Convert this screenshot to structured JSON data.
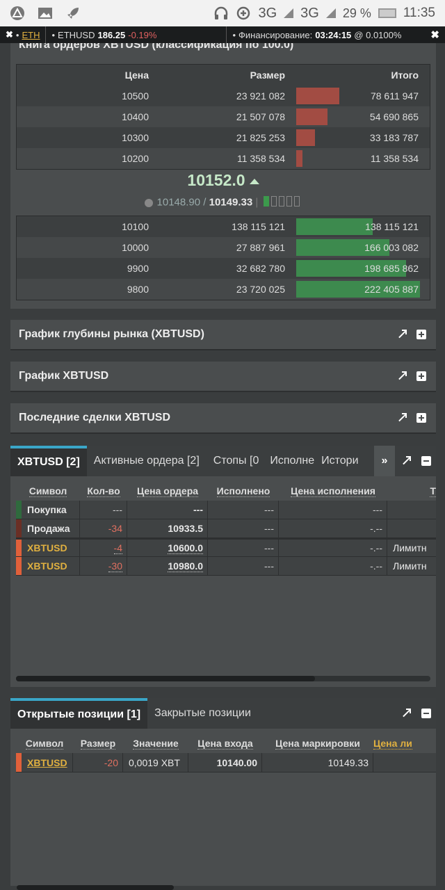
{
  "status_bar": {
    "network1": "3G",
    "network2": "3G",
    "battery": "29 %",
    "time": "11:35"
  },
  "ticker": {
    "coin": "ETH",
    "symbol": "ETHUSD",
    "price": "186.25",
    "change": "-0.19%",
    "funding_label": "Финансирование:",
    "funding_time": "03:24:15",
    "funding_rate": "@ 0.0100%"
  },
  "orderbook": {
    "title_cut": "Книга ордеров XBTUSD (классификация по 100.0)",
    "headers": {
      "price": "Цена",
      "size": "Размер",
      "total": "Итого"
    },
    "asks": [
      {
        "price": "10500",
        "size": "23 921 082",
        "total": "78 611 947",
        "depth": 0.35
      },
      {
        "price": "10400",
        "size": "21 507 078",
        "total": "54 690 865",
        "depth": 0.25
      },
      {
        "price": "10300",
        "size": "21 825 253",
        "total": "33 183 787",
        "depth": 0.15
      },
      {
        "price": "10200",
        "size": "11 358 534",
        "total": "11 358 534",
        "depth": 0.05
      }
    ],
    "last_price": "10152.0",
    "index_price": "10148.90",
    "mark_price": "10149.33",
    "bids": [
      {
        "price": "10100",
        "size": "138 115 121",
        "total": "138 115 121",
        "depth": 0.62
      },
      {
        "price": "10000",
        "size": "27 887 961",
        "total": "166 003 082",
        "depth": 0.75
      },
      {
        "price": "9900",
        "size": "32 682 780",
        "total": "198 685 862",
        "depth": 0.89
      },
      {
        "price": "9800",
        "size": "23 720 025",
        "total": "222 405 887",
        "depth": 1.0
      }
    ],
    "colors": {
      "ask_bar": "#a24c43",
      "bid_bar": "#3d8a4e"
    }
  },
  "panels": {
    "depth_chart": "График глубины рынка (XBTUSD)",
    "chart": "График XBTUSD",
    "recent_trades": "Последние сделки XBTUSD"
  },
  "orders": {
    "tabs": [
      "XBTUSD [2]",
      "Активные ордера [2]",
      "Стопы [0",
      "Исполне",
      "Истори"
    ],
    "more": "»",
    "headers": [
      "Символ",
      "Кол-во",
      "Цена ордера",
      "Исполнено",
      "Цена исполнения",
      "Т"
    ],
    "rows": [
      {
        "symbol": "Покупка",
        "qty": "---",
        "price": "---",
        "filled": "---",
        "exec_price": "---",
        "type": ""
      },
      {
        "symbol": "Продажа",
        "qty": "-34",
        "price": "10933.5",
        "filled": "---",
        "exec_price": "-.--",
        "type": ""
      },
      {
        "symbol": "XBTUSD",
        "qty": "-4",
        "price": "10600.0",
        "filled": "---",
        "exec_price": "-.--",
        "type": "Лимитн"
      },
      {
        "symbol": "XBTUSD",
        "qty": "-30",
        "price": "10980.0",
        "filled": "---",
        "exec_price": "-.--",
        "type": "Лимитн"
      }
    ]
  },
  "positions": {
    "tabs": [
      "Открытые позиции [1]",
      "Закрытые позиции"
    ],
    "headers": [
      "Символ",
      "Размер",
      "Значение",
      "Цена входа",
      "Цена маркировки",
      "Цена ли"
    ],
    "rows": [
      {
        "symbol": "XBTUSD",
        "size": "-20",
        "value": "0,0019 XBT",
        "entry": "10140.00",
        "mark": "10149.33",
        "liq": ""
      }
    ]
  }
}
